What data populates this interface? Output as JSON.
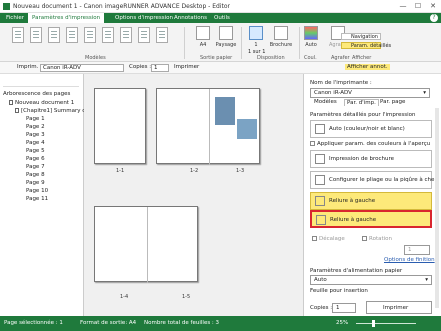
{
  "window": {
    "title": "Nouveau document 1 - Canon imageRUNNER ADVANCE Desktop - Editor",
    "minimize": "—",
    "maximize": "☐",
    "close": "✕"
  },
  "tabs": [
    "Fichier",
    "Paramètres d'impression",
    "Options d'impression",
    "Annotations",
    "Outils"
  ],
  "help": "?",
  "ribbon": {
    "groups": {
      "modeles": "Modèles",
      "sortie": "Sortie papier",
      "disposition": "Disposition",
      "coul": "Coul.",
      "agrafer": "Agrafer",
      "afficher": "Afficher"
    },
    "paper": "A4",
    "orientation": "Paysage",
    "pages_per_sheet": "1",
    "pages_sub": "1 sur 1",
    "binding": "Brochure",
    "color": "Auto",
    "staple": "Agrafer",
    "navigation": "Navigation",
    "param_details": "Param. détaillés"
  },
  "toolbar": {
    "printer_label": "Imprim. :",
    "printer": "Canon iR-ADV",
    "copies_label": "Copies :",
    "copies": "1",
    "print": "Imprimer",
    "display_annot": "Afficher annot."
  },
  "tree": {
    "title": "Arborescence des pages",
    "doc": "Nouveau document 1",
    "chapter": "[Chapitre1] Summary o",
    "pages": [
      "Page 1",
      "Page 2",
      "Page 3",
      "Page 4",
      "Page 5",
      "Page 6",
      "Page 7",
      "Page 8",
      "Page 9",
      "Page 10",
      "Page 11"
    ]
  },
  "preview": {
    "labels": [
      "1-1",
      "1-2",
      "1-3",
      "1-4",
      "1-5"
    ]
  },
  "panel": {
    "printer_name_label": "Nom de l'imprimante :",
    "printer_name": "Canon iR-ADV",
    "tabs": [
      "Modèles",
      "Par. d'imp.",
      "Par. page"
    ],
    "detail_label": "Paramètres détaillés pour l'impression",
    "color_mode": "Auto (couleur/noir et blanc)",
    "apply_colors": "Appliquer param. des couleurs à l'aperçu",
    "brochure": "Impression de brochure",
    "config_fold": "Configurer le pliage ou la piqûre à che",
    "reliure_sel": "Reliure à gauche",
    "reliure_opt": "Reliure à gauche",
    "decalage": "Décalage",
    "rotation": "Rotation",
    "rot_value": "1",
    "finishing_options": "Options de finition",
    "paper_feed_label": "Paramètres d'alimentation papier",
    "paper_feed": "Auto",
    "cover_label": "Feuille pour insertion",
    "copies_label": "Copies :",
    "copies": "1",
    "print": "Imprimer"
  },
  "status": {
    "selected": "Page sélectionnée : 1",
    "format": "Format de sortie: A4",
    "total": "Nombre total de feuilles : 3",
    "zoom": "25%"
  }
}
